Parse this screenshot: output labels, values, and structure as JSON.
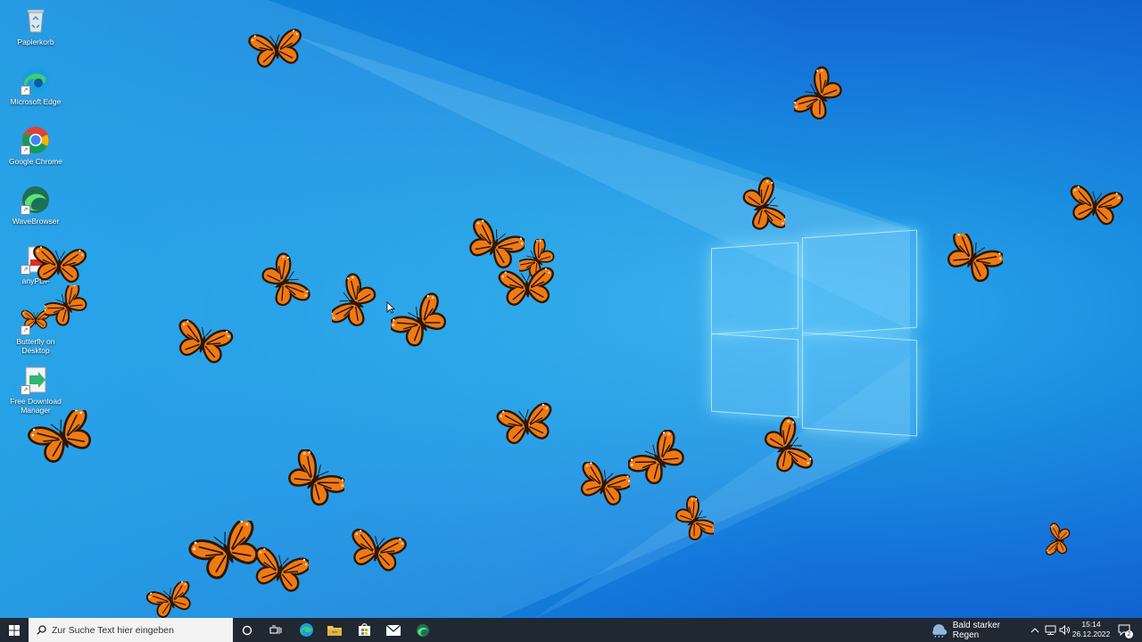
{
  "desktop_icons": [
    {
      "label": "Papierkorb",
      "icon": "recycle-bin-icon"
    },
    {
      "label": "Microsoft Edge",
      "icon": "edge-icon"
    },
    {
      "label": "Google Chrome",
      "icon": "chrome-icon"
    },
    {
      "label": "WaveBrowser",
      "icon": "wavebrowser-icon"
    },
    {
      "label": "anyPDF",
      "icon": "pdf-icon"
    },
    {
      "label": "Butterfly on Desktop",
      "icon": "butterfly-icon"
    },
    {
      "label": "Free Download Manager",
      "icon": "download-manager-icon"
    }
  ],
  "taskbar": {
    "start_icon": "windows-start-icon",
    "search_placeholder": "Zur Suche Text hier eingeben",
    "pinned": [
      "cortana-icon",
      "task-view-icon",
      "edge-icon",
      "file-explorer-icon",
      "store-icon",
      "mail-icon",
      "wavebrowser-icon"
    ]
  },
  "tray": {
    "weather_text": "Bald starker Regen",
    "time": "15:14",
    "date": "26.12.2022",
    "notification_count": "2"
  },
  "colors": {
    "butterfly_orange": "#f07a12",
    "butterfly_dark": "#2b1608",
    "taskbar_bg": "#1f2833",
    "desktop_blue": "#1a8fe0"
  }
}
